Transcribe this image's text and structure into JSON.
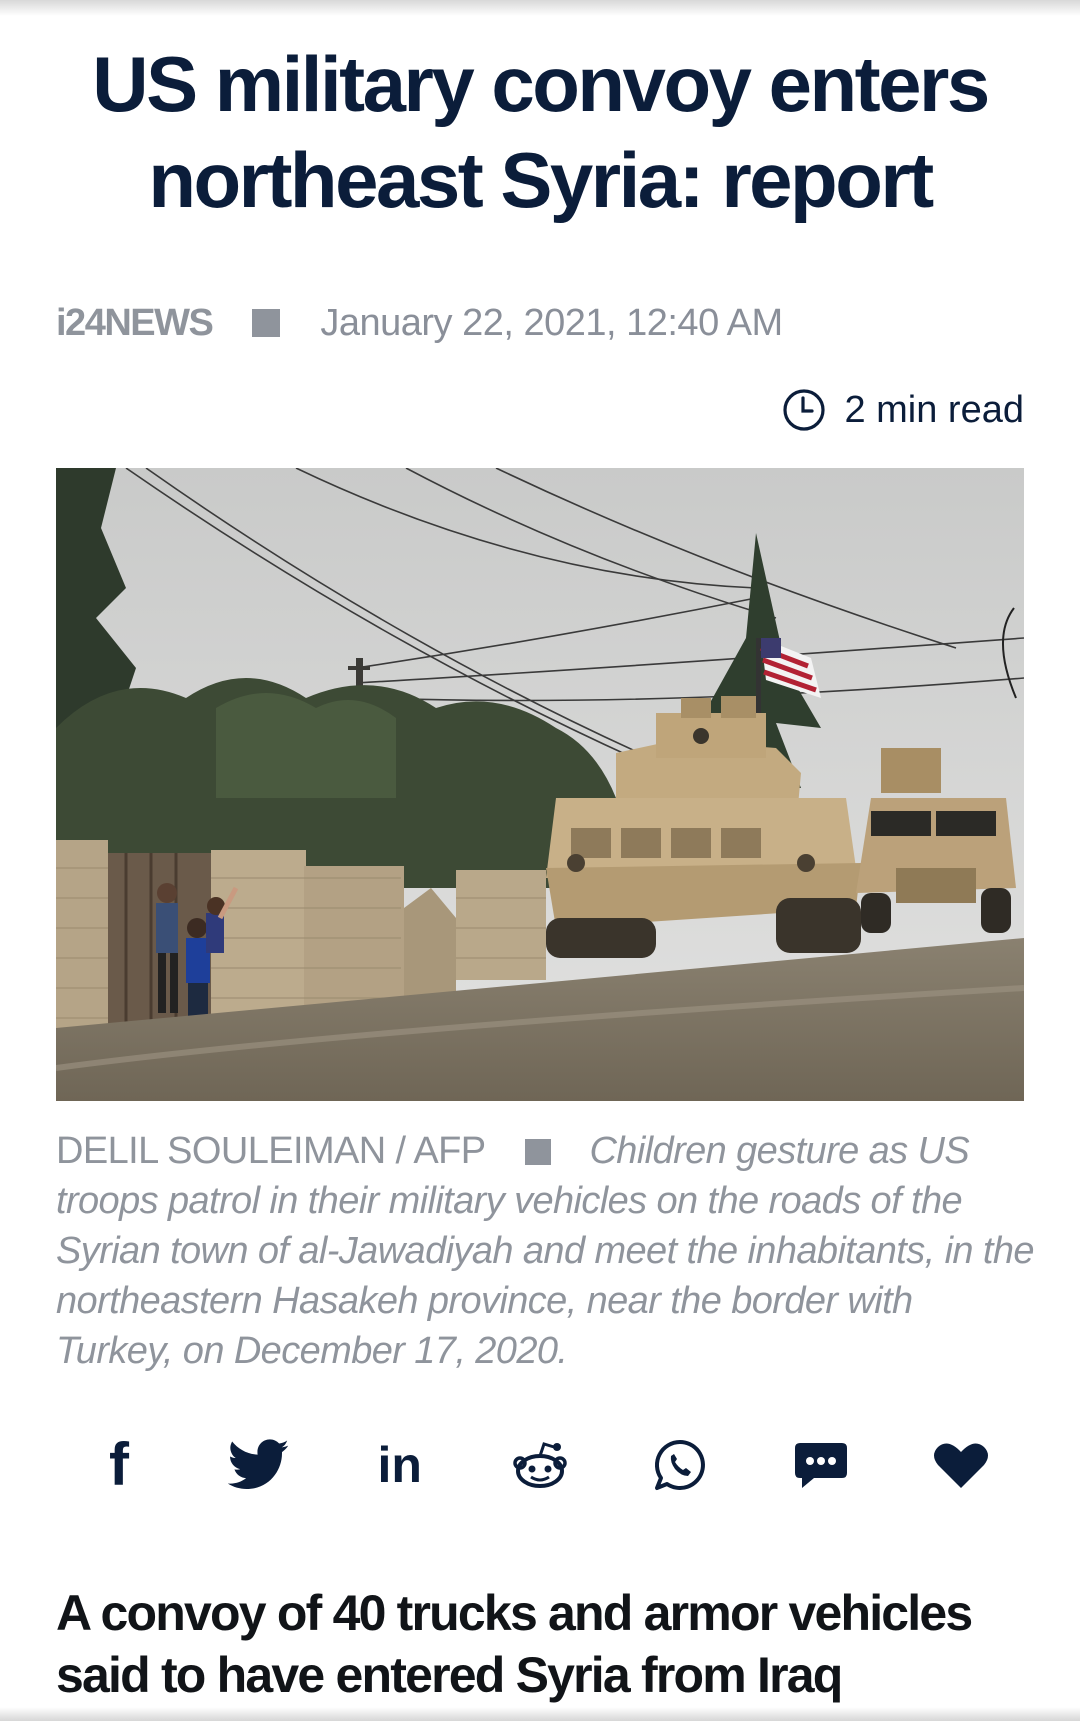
{
  "article": {
    "headline": "US military convoy enters northeast Syria: report",
    "source": "i24NEWS",
    "date": "January 22, 2021, 12:40 AM",
    "read_time": "2 min read",
    "image_credit": "DELIL SOULEIMAN / AFP",
    "image_caption": "Children gesture as US troops patrol in their military vehicles on the roads of the Syrian town of al-Jawadiyah and meet the inhabitants, in the northeastern Hasakeh province, near the border with Turkey, on December 17, 2020.",
    "subheadline": "A convoy of 40 trucks and armor vehicles said to have entered Syria from Iraq"
  },
  "share": {
    "facebook_glyph": "f",
    "linkedin_glyph": "in",
    "icons": [
      "facebook-icon",
      "twitter-icon",
      "linkedin-icon",
      "reddit-icon",
      "whatsapp-icon",
      "comment-icon",
      "heart-icon"
    ]
  },
  "colors": {
    "navy": "#0b1d3a",
    "muted_gray": "#8f949c"
  }
}
